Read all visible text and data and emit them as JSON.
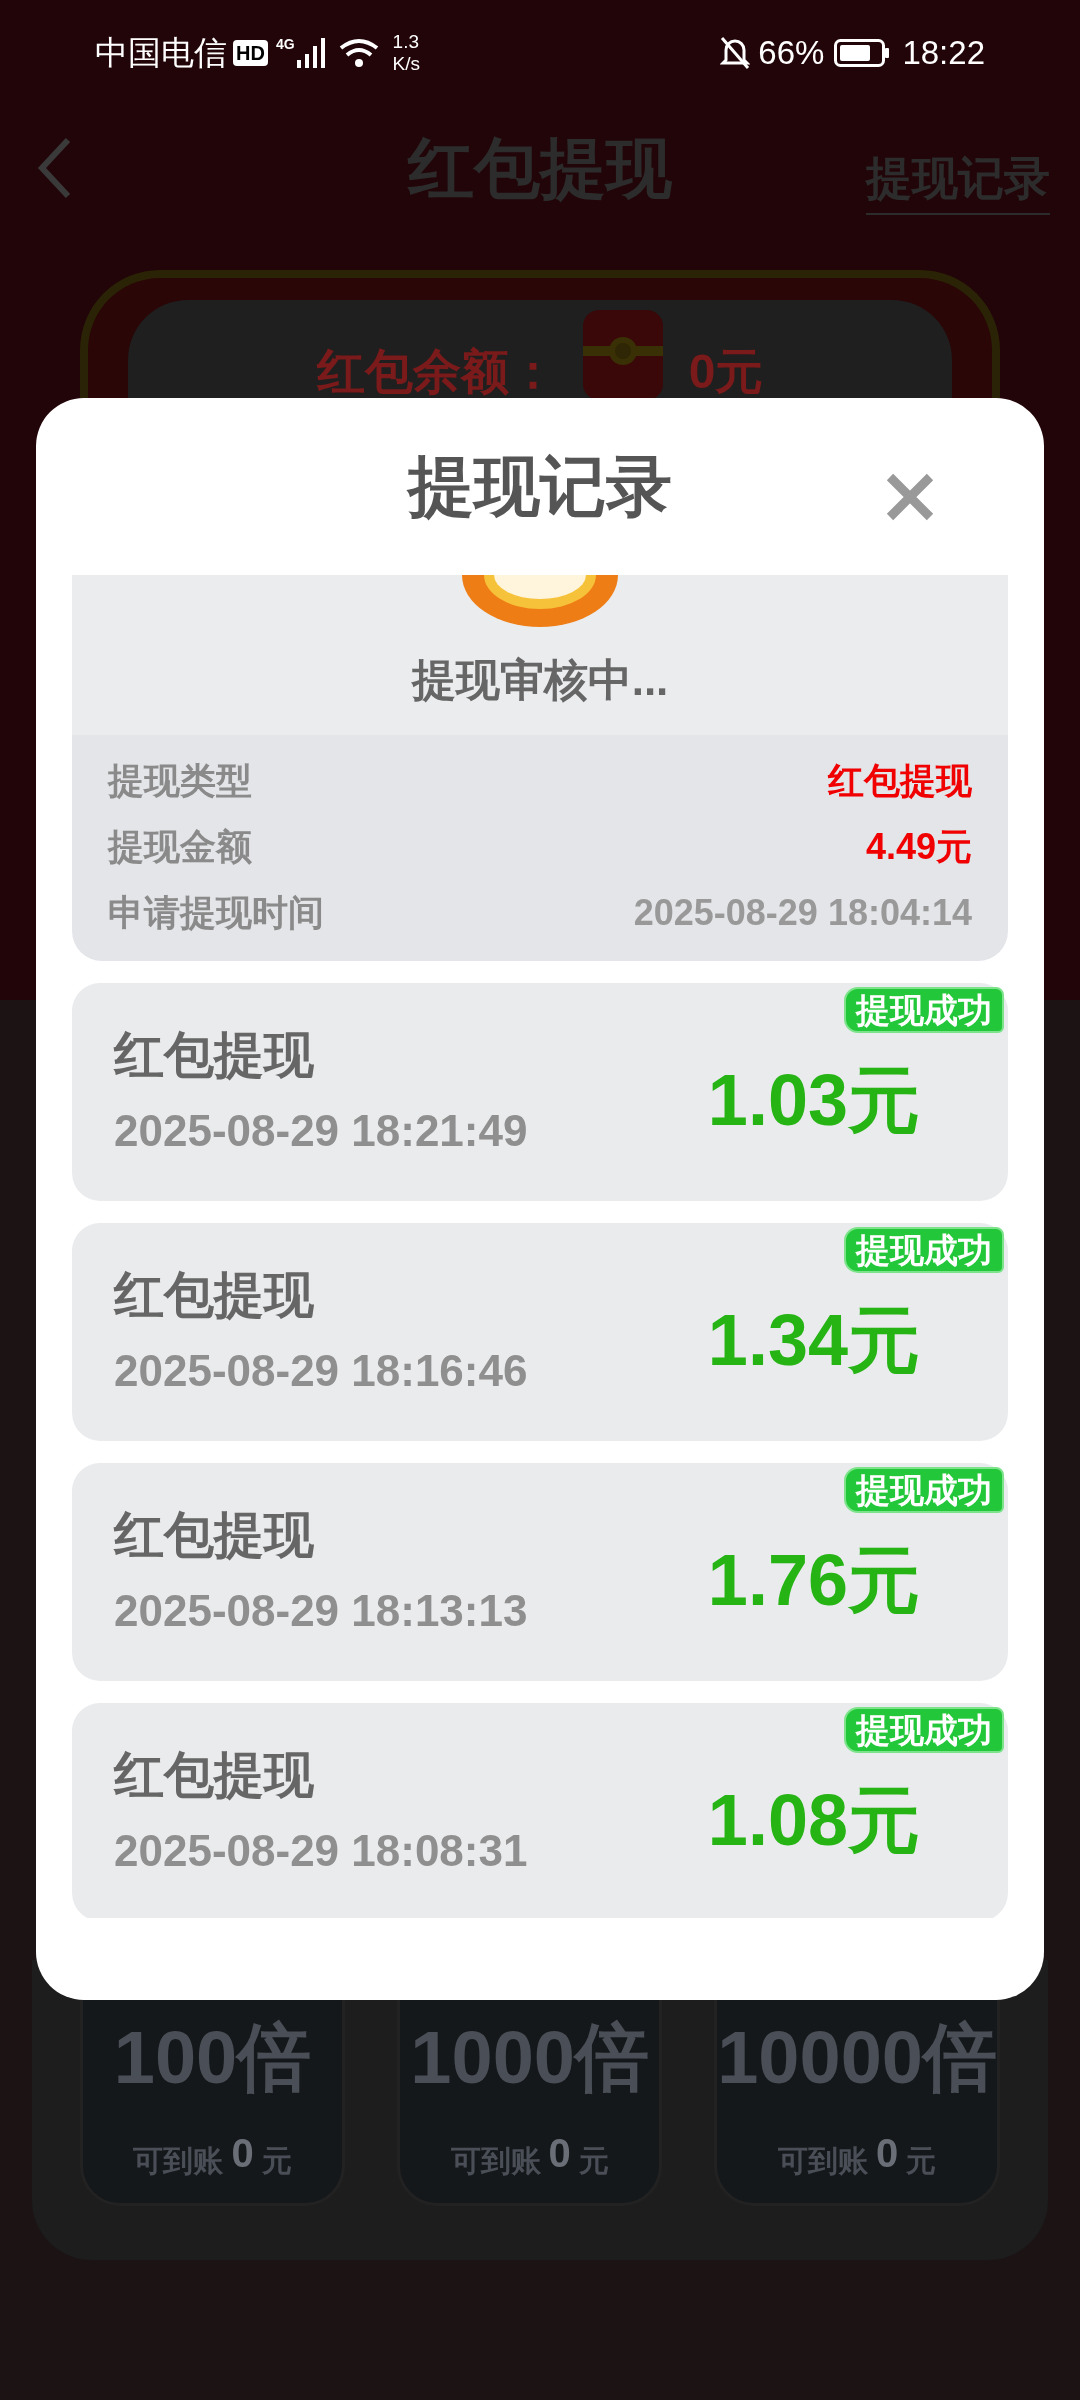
{
  "status_bar": {
    "carrier": "中国电信",
    "hd": "HD",
    "network": "4G",
    "speed": [
      "1.3",
      "K/s"
    ],
    "battery": "66%",
    "time": "18:22"
  },
  "header": {
    "title": "红包提现",
    "link": "提现记录"
  },
  "balance": {
    "label": "红包余额：",
    "amount": "0元"
  },
  "multipliers": [
    {
      "label": "100倍",
      "caption": "可到账",
      "amount": "0",
      "unit": "元"
    },
    {
      "label": "1000倍",
      "caption": "可到账",
      "amount": "0",
      "unit": "元"
    },
    {
      "label": "10000倍",
      "caption": "可到账",
      "amount": "0",
      "unit": "元"
    }
  ],
  "dialog": {
    "title": "提现记录",
    "pending": {
      "status": "提现审核中...",
      "rows": [
        {
          "label": "提现类型",
          "value": "红包提现",
          "highlight": true
        },
        {
          "label": "提现金额",
          "value": "4.49元",
          "highlight": true
        },
        {
          "label": "申请提现时间",
          "value": "2025-08-29 18:04:14",
          "highlight": false
        }
      ]
    },
    "records": [
      {
        "title": "红包提现",
        "time": "2025-08-29 18:21:49",
        "amount": "1.03元",
        "badge": "提现成功"
      },
      {
        "title": "红包提现",
        "time": "2025-08-29 18:16:46",
        "amount": "1.34元",
        "badge": "提现成功"
      },
      {
        "title": "红包提现",
        "time": "2025-08-29 18:13:13",
        "amount": "1.76元",
        "badge": "提现成功"
      },
      {
        "title": "红包提现",
        "time": "2025-08-29 18:08:31",
        "amount": "1.08元",
        "badge": "提现成功"
      }
    ]
  }
}
